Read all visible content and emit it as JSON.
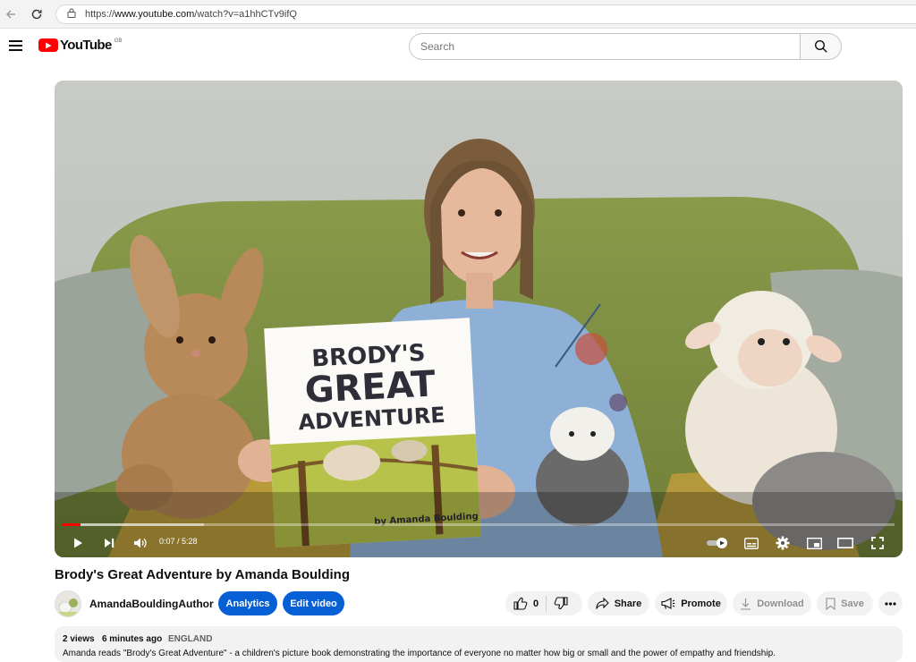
{
  "browser": {
    "url_scheme": "https://",
    "url_host": "www.youtube.com",
    "url_path": "/watch?v=a1hhCTv9ifQ"
  },
  "header": {
    "logo_text": "YouTube",
    "region_code": "GB",
    "search_placeholder": "Search"
  },
  "player": {
    "time_label": "0:07 / 5:28",
    "progress_fraction": 0.021,
    "buffered_fraction": 0.17,
    "book_title_line1": "BRODY'S",
    "book_title_line2": "GREAT",
    "book_title_line3": "ADVENTURE",
    "book_author": "by Amanda Boulding"
  },
  "video": {
    "title": "Brody's Great Adventure by Amanda Boulding"
  },
  "channel": {
    "name": "AmandaBouldingAuthor",
    "analytics_label": "Analytics",
    "edit_label": "Edit video"
  },
  "actions": {
    "like_count": "0",
    "share_label": "Share",
    "promote_label": "Promote",
    "download_label": "Download",
    "save_label": "Save"
  },
  "description": {
    "views": "2 views",
    "age": "6 minutes ago",
    "location": "ENGLAND",
    "text": "Amanda reads \"Brody's Great Adventure\" - a children's picture book demonstrating the importance of everyone no matter how big or small and the power of empathy and friendship."
  },
  "colors": {
    "brand_red": "#ff0000",
    "primary_blue": "#065fd4",
    "chip_grey": "#f2f2f2"
  }
}
